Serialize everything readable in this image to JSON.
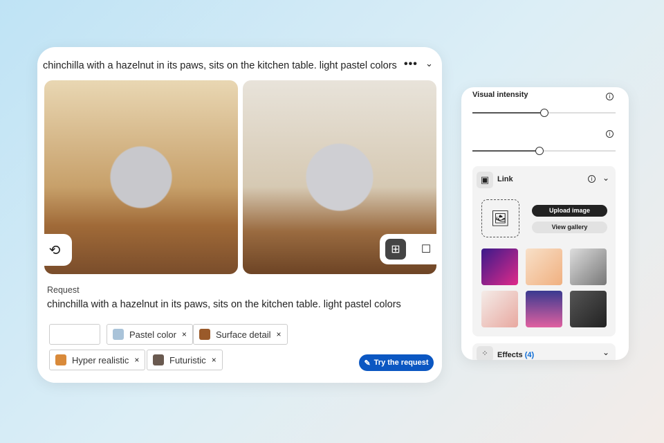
{
  "prompt_card": {
    "title": "chinchilla with a hazelnut in its paws, sits on the kitchen table. light pastel colors",
    "more": "•••",
    "request_label": "Request",
    "request_text": "chinchilla with a hazelnut in its paws, sits on the kitchen table. light pastel colors",
    "tags": [
      {
        "label": "Pastel color",
        "color": "#a9c3d9"
      },
      {
        "label": "Surface detail",
        "color": "#9a5a2a"
      },
      {
        "label": "Hyper realistic",
        "color": "#d98a3a"
      },
      {
        "label": "Futuristic",
        "color": "#6a5a50"
      }
    ],
    "remove": "×",
    "try_button": "Try the request"
  },
  "settings": {
    "visual_intensity_label": "Visual intensity",
    "slider1_value": 0.5,
    "slider2_value": 0.47,
    "link_label": "Link",
    "upload_button": "Upload image",
    "gallery_button": "View gallery",
    "effects_label": "Effects",
    "effects_count": "(4)"
  },
  "colors": {
    "accent": "#0b57c2"
  }
}
